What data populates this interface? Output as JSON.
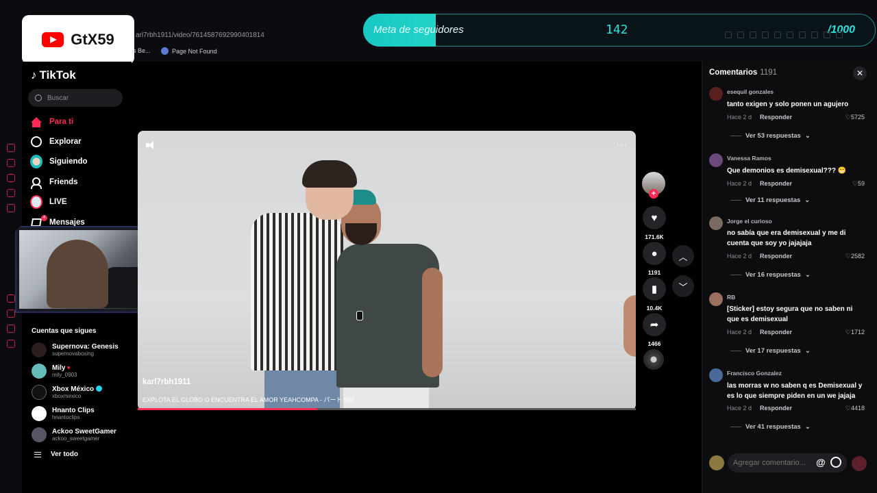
{
  "browser": {
    "url": "arl7rbh1911/video/7614587692990401814",
    "bookmarks": [
      {
        "label": "s Be..."
      },
      {
        "label": "Page Not Found"
      }
    ]
  },
  "stream_overlay": {
    "channel_badge": "GtX59",
    "follower_goal": {
      "label": "Meta de seguidores",
      "current": "142",
      "target": "/1000",
      "progress": 0.142
    }
  },
  "colors": {
    "accent": "#fe2c55",
    "goal": "#2be0da"
  },
  "sidebar": {
    "logo": "TikTok",
    "search_placeholder": "Buscar",
    "nav": [
      {
        "label": "Para ti",
        "icon": "home-icon",
        "active": true
      },
      {
        "label": "Explorar",
        "icon": "compass-icon"
      },
      {
        "label": "Siguiendo",
        "icon": "following-avatar-icon"
      },
      {
        "label": "Friends",
        "icon": "friends-icon"
      },
      {
        "label": "LIVE",
        "icon": "live-icon"
      },
      {
        "label": "Mensajes",
        "icon": "messages-icon",
        "badge": "4"
      }
    ],
    "following_header": "Cuentas que sigues",
    "following": [
      {
        "name": "Supernova: Genesis",
        "user": "supernovaboxing"
      },
      {
        "name": "Mily",
        "user": "mily_0903",
        "heart": "♥"
      },
      {
        "name": "Xbox México",
        "user": "xboxmexico",
        "verified": true
      },
      {
        "name": "Hnanto Clips",
        "user": "hnantoclips"
      },
      {
        "name": "Ackoo SweetGamer",
        "user": "ackoo_sweetgamer"
      }
    ],
    "see_all": "Ver todo"
  },
  "video": {
    "username": "karl7rbh1911",
    "caption": "EXPLOTA EL GLOBO O ENCUENTRA EL AMOR YEAHCOMPA - パート 003",
    "progress": 0.36,
    "more": "···"
  },
  "actions": {
    "likes": "171.6K",
    "comments": "1191",
    "saves": "10.4K",
    "shares": "1466",
    "plus": "+"
  },
  "comments_panel": {
    "title": "Comentarios",
    "count": "1191",
    "reply_label": "Responder",
    "comments": [
      {
        "author": "esequil gonzales",
        "text": "tanto exigen y solo ponen un agujero",
        "time": "Hace 2 d",
        "likes": "5725",
        "replies": "Ver 53 respuestas"
      },
      {
        "author": "Vanessa Ramos",
        "text": "Que demonios es demisexual??? 😁",
        "time": "Hace 2 d",
        "likes": "59",
        "replies": "Ver 11 respuestas"
      },
      {
        "author": "Jorge el curioso",
        "text": "no sabía que era demisexual y me di cuenta que soy yo jajajaja",
        "time": "Hace 2 d",
        "likes": "2582",
        "replies": "Ver 16 respuestas"
      },
      {
        "author": "RB",
        "text": "[Sticker] estoy segura que no saben ni que es demisexual",
        "time": "Hace 2 d",
        "likes": "1712",
        "replies": "Ver 17 respuestas"
      },
      {
        "author": "Francisco Gonzalez",
        "text": "las morras w no saben q es Demisexual y es lo que siempre piden en un we jajaja",
        "time": "Hace 2 d",
        "likes": "4418",
        "replies": "Ver 41 respuestas"
      }
    ],
    "input_placeholder": "Agregar comentario...",
    "at_symbol": "@"
  }
}
